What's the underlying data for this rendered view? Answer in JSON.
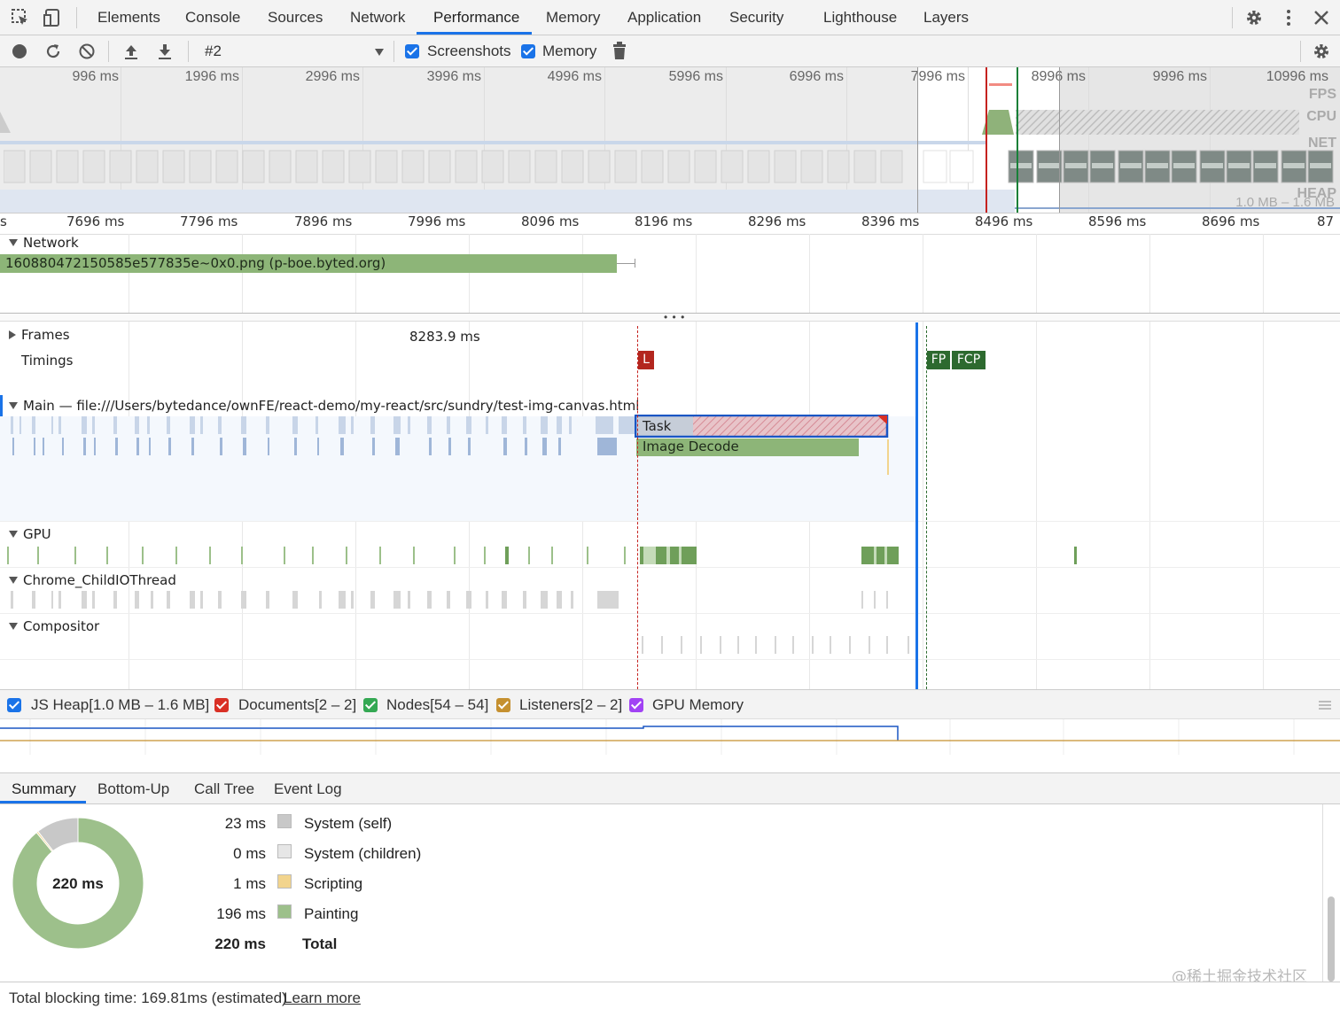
{
  "tabs": [
    {
      "label": "Elements"
    },
    {
      "label": "Console"
    },
    {
      "label": "Sources"
    },
    {
      "label": "Network"
    },
    {
      "label": "Performance"
    },
    {
      "label": "Memory"
    },
    {
      "label": "Application"
    },
    {
      "label": "Security"
    },
    {
      "label": "Lighthouse"
    },
    {
      "label": "Layers"
    }
  ],
  "active_tab": "Performance",
  "toolbar": {
    "profile_select": "#2",
    "screenshots_label": "Screenshots",
    "memory_label": "Memory",
    "screenshots_checked": true,
    "memory_checked": true
  },
  "overview": {
    "ticks": [
      "996 ms",
      "1996 ms",
      "2996 ms",
      "3996 ms",
      "4996 ms",
      "5996 ms",
      "6996 ms",
      "7996 ms",
      "8996 ms",
      "9996 ms",
      "10996 ms"
    ],
    "row_labels": {
      "fps": "FPS",
      "cpu": "CPU",
      "net": "NET",
      "heap": "HEAP"
    },
    "heap_range": "1.0 MB – 1.6 MB"
  },
  "ruler": {
    "start_fragment": "s",
    "ticks": [
      "7696 ms",
      "7796 ms",
      "7896 ms",
      "7996 ms",
      "8096 ms",
      "8196 ms",
      "8296 ms",
      "8396 ms",
      "8496 ms",
      "8596 ms",
      "8696 ms"
    ],
    "end_fragment": "87"
  },
  "tracks": {
    "network": {
      "label": "Network",
      "request": "160880472150585e577835e~0x0.png (p-boe.byted.org)"
    },
    "frames": {
      "label": "Frames",
      "duration": "8283.9 ms"
    },
    "timings": {
      "label": "Timings",
      "markers": {
        "l": "L",
        "fp": "FP",
        "fcp": "FCP"
      }
    },
    "main": {
      "label": "Main — file:///Users/bytedance/ownFE/react-demo/my-react/src/sundry/test-img-canvas.html",
      "task": "Task",
      "decode": "Image Decode"
    },
    "gpu": {
      "label": "GPU"
    },
    "io": {
      "label": "Chrome_ChildIOThread"
    },
    "compositor": {
      "label": "Compositor"
    }
  },
  "counters": [
    {
      "label": "JS Heap[1.0 MB – 1.6 MB]",
      "color": "#1a73e8"
    },
    {
      "label": "Documents[2 – 2]",
      "color": "#d93025"
    },
    {
      "label": "Nodes[54 – 54]",
      "color": "#188038"
    },
    {
      "label": "Listeners[2 – 2]",
      "color": "#b06000"
    },
    {
      "label": "GPU Memory",
      "color": "#a142f4"
    }
  ],
  "bottom_tabs": [
    "Summary",
    "Bottom-Up",
    "Call Tree",
    "Event Log"
  ],
  "summary": {
    "total_center": "220 ms",
    "rows": [
      {
        "value": "23 ms",
        "label": "System (self)",
        "color": "#c8c8c8"
      },
      {
        "value": "0 ms",
        "label": "System (children)",
        "color": "#e6e6e6"
      },
      {
        "value": "1 ms",
        "label": "Scripting",
        "color": "#f2d48d"
      },
      {
        "value": "196 ms",
        "label": "Painting",
        "color": "#9dc08b"
      }
    ],
    "total_value": "220 ms",
    "total_label": "Total"
  },
  "status": {
    "text": "Total blocking time: 169.81ms (estimated)",
    "link": "Learn more"
  },
  "watermark": "@稀土掘金技术社区"
}
